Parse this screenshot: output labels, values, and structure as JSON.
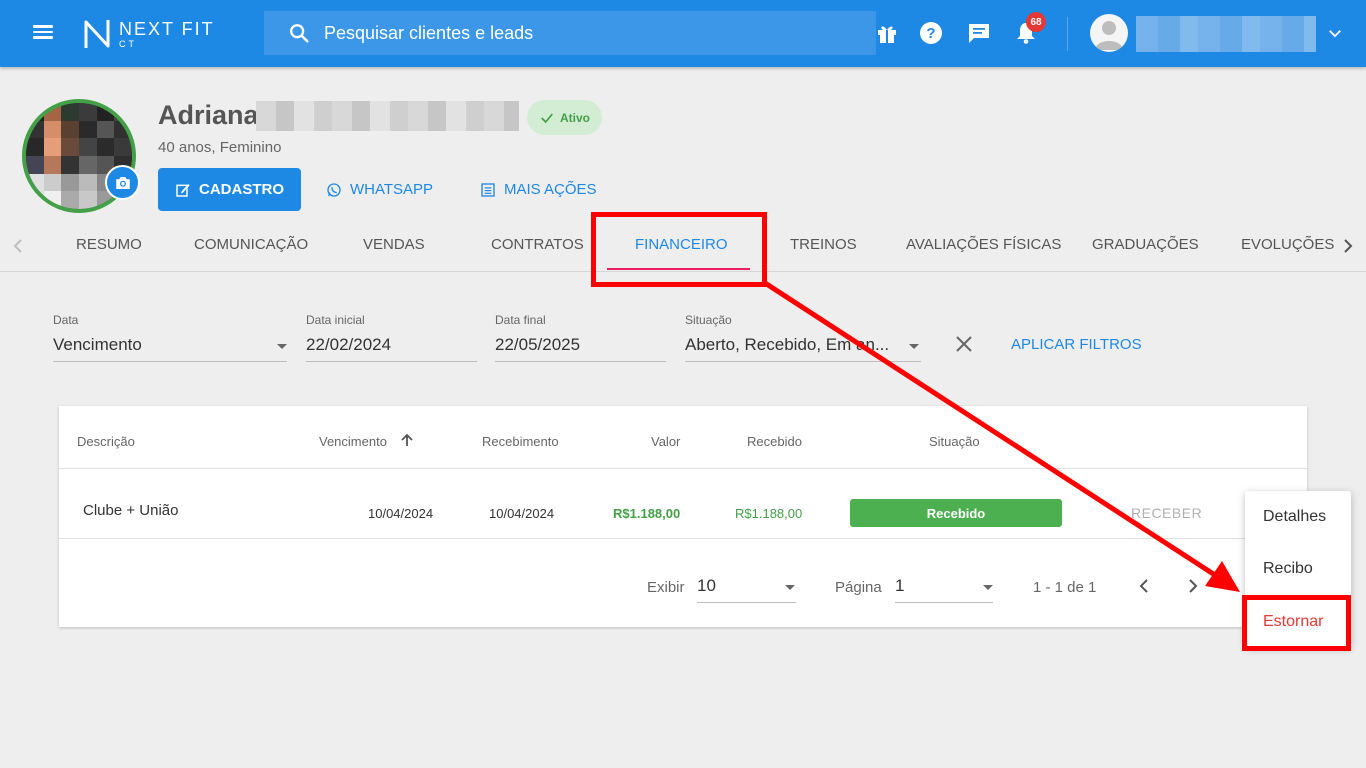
{
  "header": {
    "logo_big": "NEXT FIT",
    "logo_small": "CT",
    "search_placeholder": "Pesquisar clientes e leads",
    "notifications_count": "68"
  },
  "client": {
    "name": "Adriana",
    "status": "Ativo",
    "subtitle": "40 anos, Feminino",
    "actions": {
      "cadastro": "CADASTRO",
      "whatsapp": "WHATSAPP",
      "mais_acoes": "MAIS AÇÕES"
    }
  },
  "tabs": [
    "RESUMO",
    "COMUNICAÇÃO",
    "VENDAS",
    "CONTRATOS",
    "FINANCEIRO",
    "TREINOS",
    "AVALIAÇÕES FÍSICAS",
    "GRADUAÇÕES",
    "EVOLUÇÕES"
  ],
  "active_tab": "FINANCEIRO",
  "filters": {
    "data_label": "Data",
    "data_value": "Vencimento",
    "inicial_label": "Data inicial",
    "inicial_value": "22/02/2024",
    "final_label": "Data final",
    "final_value": "22/05/2025",
    "situacao_label": "Situação",
    "situacao_value": "Aberto, Recebido, Em an...",
    "apply_label": "APLICAR FILTROS"
  },
  "table": {
    "headers": {
      "descricao": "Descrição",
      "vencimento": "Vencimento",
      "recebimento": "Recebimento",
      "valor": "Valor",
      "recebido": "Recebido",
      "situacao": "Situação"
    },
    "rows": [
      {
        "descricao": "Clube + União",
        "vencimento": "10/04/2024",
        "recebimento": "10/04/2024",
        "valor": "R$1.188,00",
        "recebido": "R$1.188,00",
        "situacao": "Recebido",
        "action": "RECEBER"
      }
    ]
  },
  "pagination": {
    "exibir_label": "Exibir",
    "exibir_value": "10",
    "pagina_label": "Página",
    "pagina_value": "1",
    "range": "1 - 1 de 1"
  },
  "context_menu": {
    "items": [
      "Detalhes",
      "Recibo",
      "Estornar"
    ]
  },
  "colors": {
    "primary": "#1e88e5",
    "success": "#4caf50",
    "danger": "#e53935",
    "annotation": "#ff0000",
    "tab_underline": "#e91e63"
  }
}
